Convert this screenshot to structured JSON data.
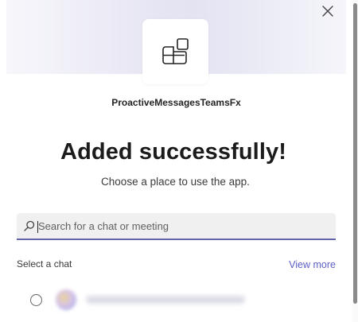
{
  "dialog": {
    "app_name": "ProactiveMessagesTeamsFx",
    "headline": "Added successfully!",
    "subline": "Choose a place to use the app.",
    "close_icon": "close-icon",
    "app_icon": "apps-grid-icon"
  },
  "search": {
    "placeholder": "Search for a chat or meeting",
    "value": "",
    "icon": "search-icon"
  },
  "chats": {
    "section_label": "Select a chat",
    "view_more_label": "View more",
    "items": [
      {
        "selected": false,
        "name_redacted": true
      }
    ]
  },
  "colors": {
    "accent": "#6264a7",
    "link": "#5b5fc7",
    "hero_gradient": [
      "#f7f7fb",
      "#e3e3f2"
    ]
  }
}
